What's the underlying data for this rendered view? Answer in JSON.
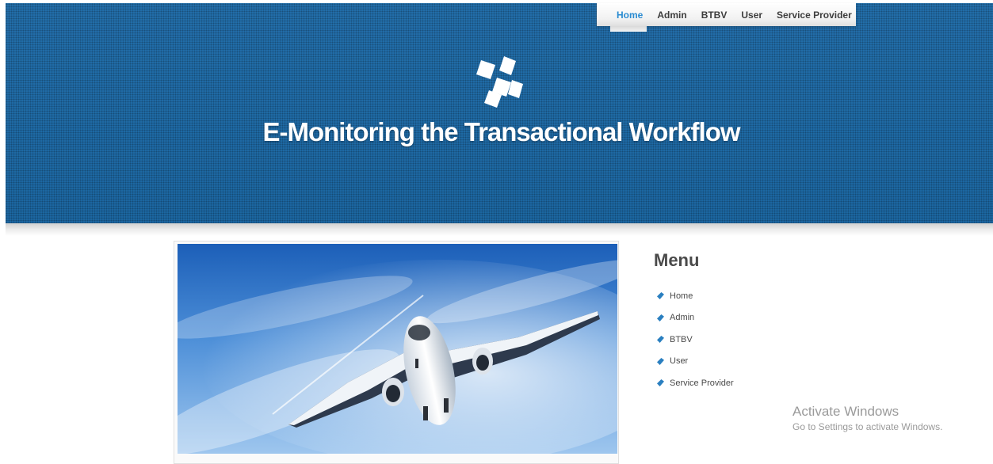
{
  "nav": {
    "items": [
      {
        "label": "Home",
        "active": true
      },
      {
        "label": "Admin"
      },
      {
        "label": "BTBV"
      },
      {
        "label": "User"
      },
      {
        "label": "Service Provider"
      }
    ]
  },
  "header": {
    "title": "E-Monitoring the Transactional Workflow"
  },
  "hero": {
    "image_icon": "airplane-photo"
  },
  "sidebar": {
    "title": "Menu",
    "items": [
      {
        "label": "Home"
      },
      {
        "label": "Admin"
      },
      {
        "label": "BTBV"
      },
      {
        "label": "User"
      },
      {
        "label": "Service Provider"
      }
    ]
  },
  "watermark": {
    "title": "Activate Windows",
    "subtitle": "Go to Settings to activate Windows."
  },
  "colors": {
    "banner": "#1d6aa5",
    "nav_active": "#2a8bd1",
    "bullet": "#2a7fc0"
  }
}
